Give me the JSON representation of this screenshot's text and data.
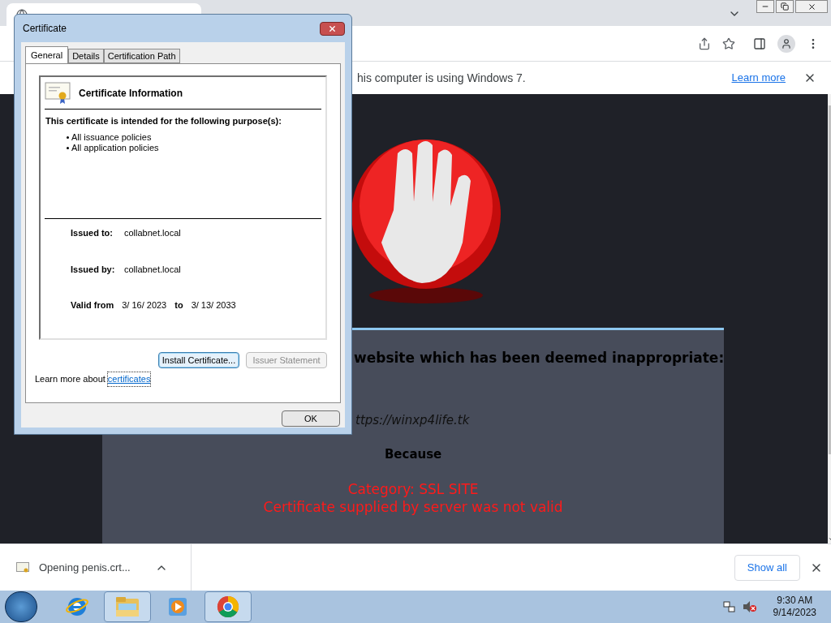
{
  "browser": {
    "infobar": {
      "message": "his computer is using Windows 7.",
      "link": "Learn more"
    },
    "page": {
      "heading": "website which has been deemed inappropriate:",
      "url": "ttps://winxp4life.tk",
      "because": "Because",
      "reasons": [
        "Category: SSL SITE",
        "Certificate supplied by server was not valid"
      ]
    },
    "downloads": {
      "item": "Opening penis.crt...",
      "show_all": "Show all"
    }
  },
  "dialog": {
    "title": "Certificate",
    "tabs": [
      {
        "label": "General",
        "selected": true
      },
      {
        "label": "Details",
        "selected": false
      },
      {
        "label": "Certification Path",
        "selected": false
      }
    ],
    "info_title": "Certificate Information",
    "purpose_heading": "This certificate is intended for the following purpose(s):",
    "policies": [
      "All issuance policies",
      "All application policies"
    ],
    "fields": [
      {
        "label": "Issued to:",
        "value": "collabnet.local"
      },
      {
        "label": "Issued by:",
        "value": "collabnet.local"
      }
    ],
    "valid": {
      "from_label": "Valid from",
      "from": "3/ 16/ 2023",
      "to_label": "to",
      "to": "3/ 13/ 2033"
    },
    "buttons": [
      {
        "label": "Install Certificate...",
        "disabled": false
      },
      {
        "label": "Issuer Statement",
        "disabled": true
      }
    ],
    "learn_more": {
      "text": "Learn more about",
      "link": "certificates"
    },
    "ok": "OK"
  },
  "taskbar": {
    "apps": [
      {
        "kind": "ie",
        "active": false
      },
      {
        "kind": "explorer",
        "active": true
      },
      {
        "kind": "media",
        "active": false
      },
      {
        "kind": "chrome",
        "active": true
      }
    ],
    "time": "9:30 AM",
    "date": "9/14/2023"
  }
}
